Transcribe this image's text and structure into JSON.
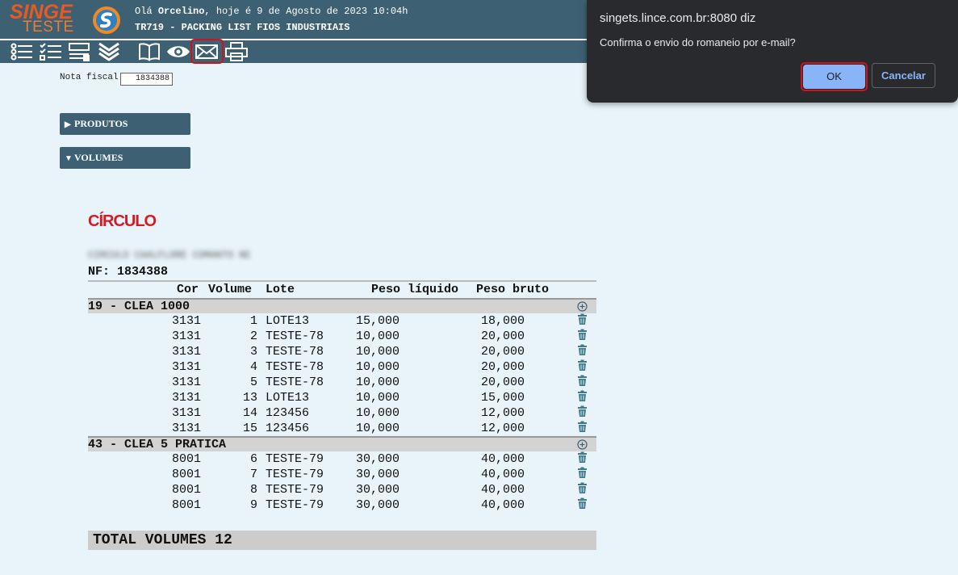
{
  "header": {
    "logo_top": "SINGE",
    "logo_bottom": "TESTE",
    "greeting_prefix": "Olá ",
    "user": "Orcelino",
    "greeting_suffix": ", hoje é 9 de Agosto de 2023 10:04h",
    "program": "TR719 - PACKING LIST FIOS INDUSTRIAIS"
  },
  "toolbar": {
    "icons": [
      "list-icon",
      "checklist-icon",
      "form-icon",
      "chevrons-down-icon",
      "book-icon",
      "eye-icon",
      "email-icon",
      "printer-icon"
    ]
  },
  "form": {
    "nf_label": "Nota fiscal",
    "nf_value": "1834388"
  },
  "sections": {
    "produtos": {
      "arrow": "▶",
      "label": "PRODUTOS"
    },
    "volumes": {
      "arrow": "▼",
      "label": "VOLUMES"
    }
  },
  "report": {
    "company": "CÍRCULO",
    "subtitle_blurred": "CIRCULO CAALFLORE COMANTO NE",
    "nf_line": "NF: 1834388",
    "columns": [
      "Cor",
      "Volume",
      "Lote",
      "Peso líquido",
      "Peso bruto"
    ],
    "groups": [
      {
        "label": "19 - CLEA 1000",
        "rows": [
          {
            "cor": "3131",
            "volume": "1",
            "lote": "LOTE13",
            "liquido": "15,000",
            "bruto": "18,000"
          },
          {
            "cor": "3131",
            "volume": "2",
            "lote": "TESTE-78",
            "liquido": "10,000",
            "bruto": "20,000"
          },
          {
            "cor": "3131",
            "volume": "3",
            "lote": "TESTE-78",
            "liquido": "10,000",
            "bruto": "20,000"
          },
          {
            "cor": "3131",
            "volume": "4",
            "lote": "TESTE-78",
            "liquido": "10,000",
            "bruto": "20,000"
          },
          {
            "cor": "3131",
            "volume": "5",
            "lote": "TESTE-78",
            "liquido": "10,000",
            "bruto": "20,000"
          },
          {
            "cor": "3131",
            "volume": "13",
            "lote": "LOTE13",
            "liquido": "10,000",
            "bruto": "15,000"
          },
          {
            "cor": "3131",
            "volume": "14",
            "lote": "123456",
            "liquido": "10,000",
            "bruto": "12,000"
          },
          {
            "cor": "3131",
            "volume": "15",
            "lote": "123456",
            "liquido": "10,000",
            "bruto": "12,000"
          }
        ]
      },
      {
        "label": "43 - CLEA 5 PRATICA",
        "rows": [
          {
            "cor": "8001",
            "volume": "6",
            "lote": "TESTE-79",
            "liquido": "30,000",
            "bruto": "40,000"
          },
          {
            "cor": "8001",
            "volume": "7",
            "lote": "TESTE-79",
            "liquido": "30,000",
            "bruto": "40,000"
          },
          {
            "cor": "8001",
            "volume": "8",
            "lote": "TESTE-79",
            "liquido": "30,000",
            "bruto": "40,000"
          },
          {
            "cor": "8001",
            "volume": "9",
            "lote": "TESTE-79",
            "liquido": "30,000",
            "bruto": "40,000"
          }
        ]
      }
    ],
    "total": "TOTAL VOLUMES 12"
  },
  "dialog": {
    "title": "singets.lince.com.br:8080 diz",
    "message": "Confirma o envio do romaneio por e-mail?",
    "ok_label": "OK",
    "cancel_label": "Cancelar"
  },
  "colors": {
    "header_bg": "#3d6173",
    "page_bg": "#e8f4f9",
    "brand_orange": "#e85a22",
    "highlight_red": "#d0121c",
    "dialog_bg": "#292a2d",
    "dialog_accent": "#8ab4f8"
  }
}
